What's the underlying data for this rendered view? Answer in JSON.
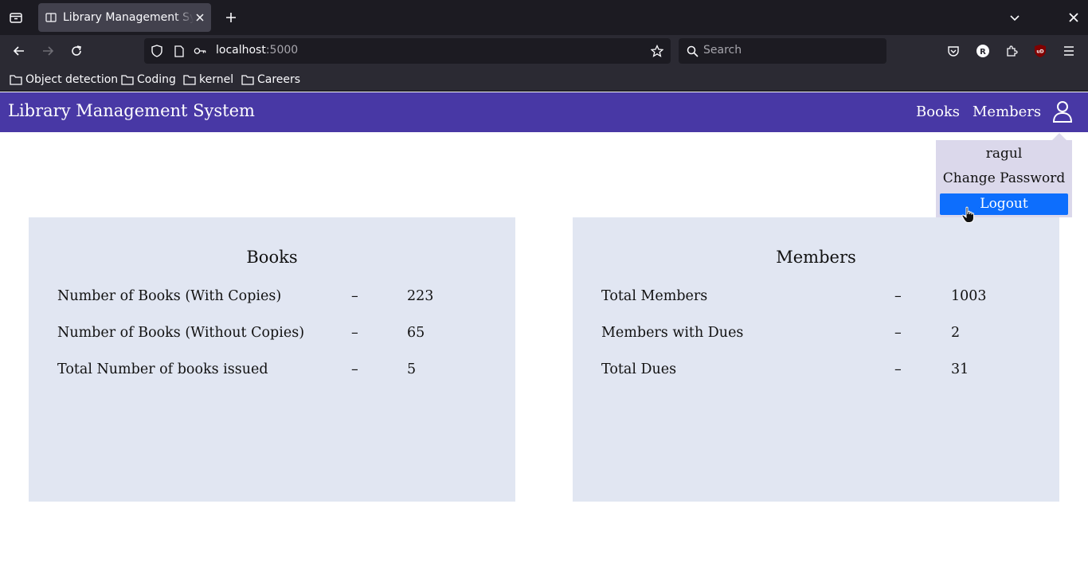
{
  "browser": {
    "tab": {
      "title": "Library Management System",
      "favicon": "book-icon"
    },
    "address": {
      "host": "localhost",
      "port": ":5000"
    },
    "search": {
      "placeholder": "Search"
    },
    "profile_initial": "R",
    "extension_badge": "uD",
    "bookmarks": [
      {
        "label": "Object detection",
        "icon": "folder-icon"
      },
      {
        "label": "Coding",
        "icon": "folder-icon"
      },
      {
        "label": "kernel",
        "icon": "folder-icon"
      },
      {
        "label": "Careers",
        "icon": "folder-icon"
      }
    ]
  },
  "header": {
    "title": "Library Management System",
    "links": [
      "Books",
      "Members"
    ],
    "user_icon": "user-icon"
  },
  "user_menu": {
    "username": "ragul",
    "change_password": "Change Password",
    "logout": "Logout"
  },
  "books_card": {
    "title": "Books",
    "rows": [
      {
        "label": "Number of Books (With Copies)",
        "sep": "–",
        "value": "223"
      },
      {
        "label": "Number of Books (Without Copies)",
        "sep": "–",
        "value": "65"
      },
      {
        "label": "Total Number of books issued",
        "sep": "–",
        "value": "5"
      }
    ]
  },
  "members_card": {
    "title": "Members",
    "rows": [
      {
        "label": "Total Members",
        "sep": "–",
        "value": "1003"
      },
      {
        "label": "Members with Dues",
        "sep": "–",
        "value": "2"
      },
      {
        "label": "Total Dues",
        "sep": "–",
        "value": "31"
      }
    ]
  },
  "colors": {
    "header_bg": "#4838a5",
    "card_bg": "#e1e6f2",
    "dropdown_bg": "#dbd8eb",
    "logout_bg": "#0d6efd"
  }
}
